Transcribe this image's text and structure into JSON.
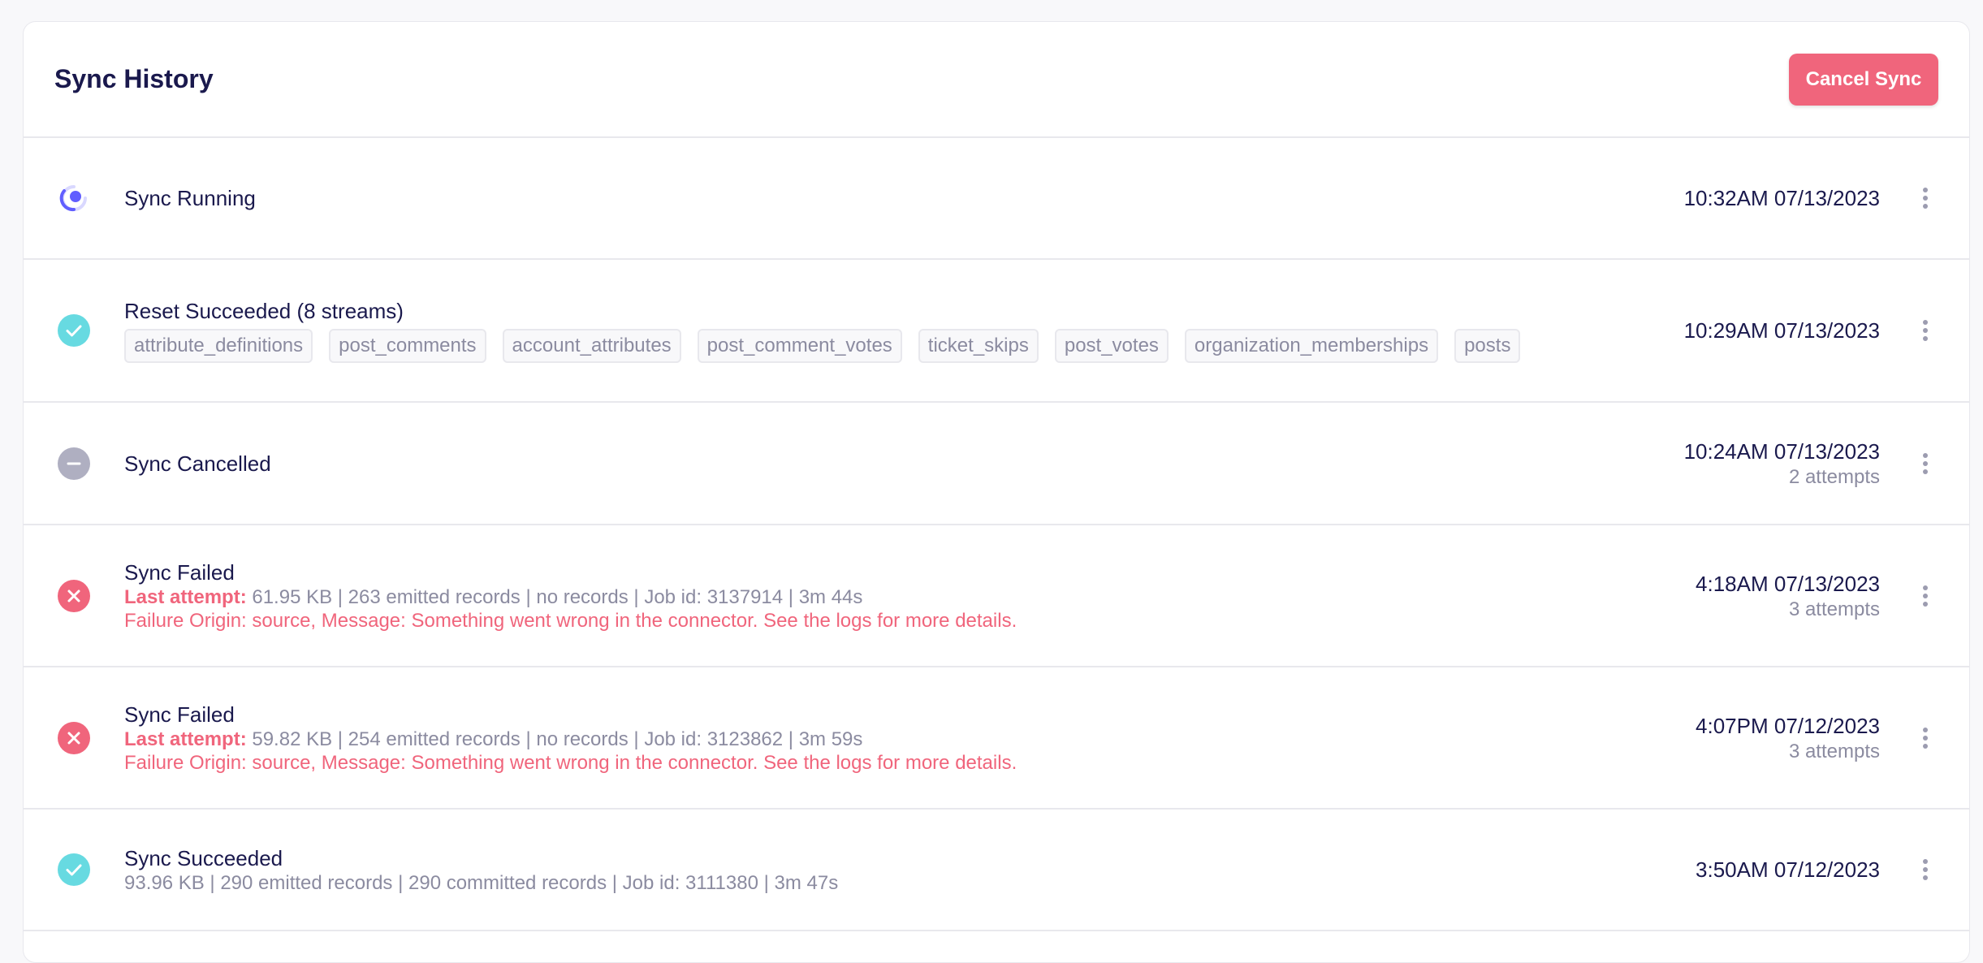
{
  "header": {
    "title": "Sync History",
    "cancel_label": "Cancel Sync"
  },
  "colors": {
    "running": "#615eff",
    "success": "#67dae1",
    "cancelled": "#afafc1",
    "failed": "#f0657c"
  },
  "jobs": [
    {
      "status": "running",
      "icon": "running-spinner-icon",
      "title": "Sync Running",
      "time": "10:32AM 07/13/2023"
    },
    {
      "status": "success",
      "icon": "check-circle-icon",
      "title": "Reset Succeeded (8 streams)",
      "streams": [
        "attribute_definitions",
        "post_comments",
        "account_attributes",
        "post_comment_votes",
        "ticket_skips",
        "post_votes",
        "organization_memberships",
        "posts"
      ],
      "time": "10:29AM 07/13/2023"
    },
    {
      "status": "cancelled",
      "icon": "minus-circle-icon",
      "title": "Sync Cancelled",
      "time": "10:24AM 07/13/2023",
      "attempts": "2 attempts"
    },
    {
      "status": "failed",
      "icon": "x-circle-icon",
      "title": "Sync Failed",
      "last_attempt_label": "Last attempt:",
      "summary": "61.95 KB | 263 emitted records | no records | Job id: 3137914 | 3m 44s",
      "failure": "Failure Origin: source, Message: Something went wrong in the connector. See the logs for more details.",
      "time": "4:18AM 07/13/2023",
      "attempts": "3 attempts"
    },
    {
      "status": "failed",
      "icon": "x-circle-icon",
      "title": "Sync Failed",
      "last_attempt_label": "Last attempt:",
      "summary": "59.82 KB | 254 emitted records | no records | Job id: 3123862 | 3m 59s",
      "failure": "Failure Origin: source, Message: Something went wrong in the connector. See the logs for more details.",
      "time": "4:07PM 07/12/2023",
      "attempts": "3 attempts"
    },
    {
      "status": "success",
      "icon": "check-circle-icon",
      "title": "Sync Succeeded",
      "summary": "93.96 KB | 290 emitted records | 290 committed records | Job id: 3111380 | 3m 47s",
      "time": "3:50AM 07/12/2023"
    }
  ]
}
